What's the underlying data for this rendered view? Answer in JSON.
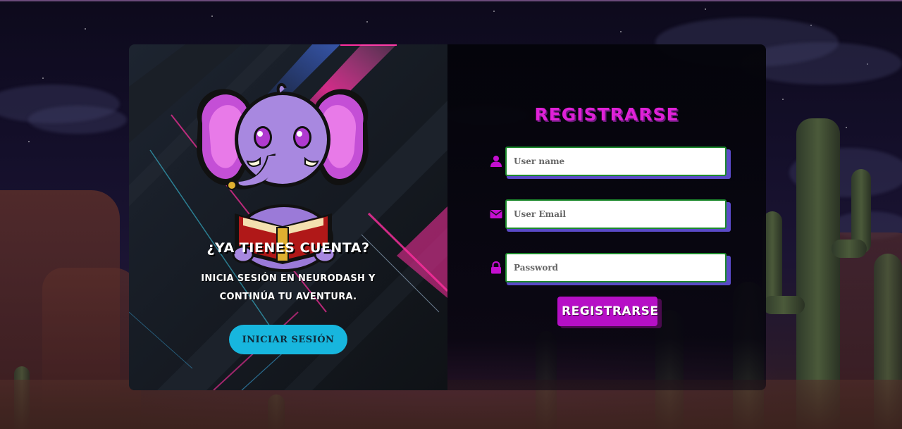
{
  "login_panel": {
    "title": "¿YA TIENES CUENTA?",
    "subtitle": "INICIA SESIóN EN NEURODASH Y CONTINúA TU AVENTURA.",
    "login_button": "INICIAR SESIÓN",
    "mascot_icon": "elephant-reading-book-icon"
  },
  "register_form": {
    "title": "REGISTRARSE",
    "fields": [
      {
        "icon": "user-icon",
        "placeholder": "User name",
        "value": ""
      },
      {
        "icon": "envelope-icon",
        "placeholder": "User Email",
        "value": ""
      },
      {
        "icon": "lock-icon",
        "placeholder": "Password",
        "value": ""
      }
    ],
    "submit_button": "REGISTRARSE"
  },
  "colors": {
    "accent_magenta": "#b60fc6",
    "title_magenta": "#e021d8",
    "login_button": "#17b6de",
    "input_border": "#1c8a2c",
    "input_shadow": "#5a4ac8"
  }
}
